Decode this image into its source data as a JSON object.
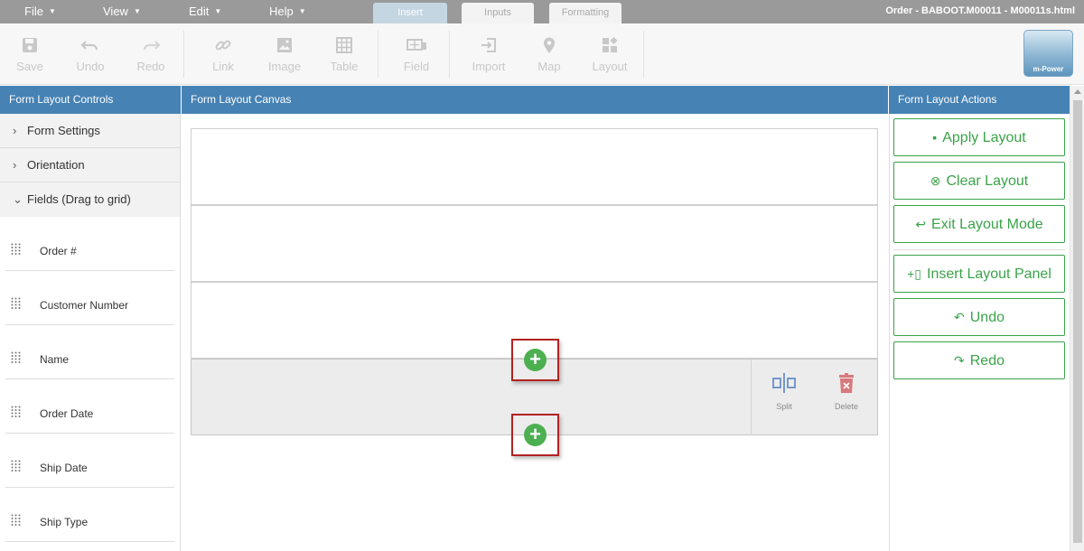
{
  "menu": {
    "file": "File",
    "view": "View",
    "edit": "Edit",
    "help": "Help"
  },
  "tabs": {
    "insert": "Insert",
    "inputs": "Inputs",
    "formatting": "Formatting"
  },
  "document_title": "Order - BABOOT.M00011 - M00011s.html",
  "toolbar": {
    "save": "Save",
    "undo": "Undo",
    "redo": "Redo",
    "link": "Link",
    "image": "Image",
    "table": "Table",
    "field": "Field",
    "import": "Import",
    "map": "Map",
    "layout": "Layout"
  },
  "logo_text": "m-Power",
  "controls": {
    "header": "Form Layout Controls",
    "sections": [
      {
        "label": "Form Settings",
        "expanded": false
      },
      {
        "label": "Orientation",
        "expanded": false
      },
      {
        "label": "Fields (Drag to grid)",
        "expanded": true
      }
    ],
    "fields": [
      "Order #",
      "Customer Number",
      "Name",
      "Order Date",
      "Ship Date",
      "Ship Type"
    ]
  },
  "canvas": {
    "header": "Form Layout Canvas",
    "row_actions": {
      "split": "Split",
      "delete": "Delete"
    },
    "add_symbol": "+"
  },
  "actions": {
    "header": "Form Layout Actions",
    "apply": "Apply Layout",
    "clear": "Clear Layout",
    "exit": "Exit Layout Mode",
    "insert_panel": "Insert Layout Panel",
    "undo": "Undo",
    "redo": "Redo"
  },
  "colors": {
    "header_blue": "#4682b4",
    "accent_green": "#3aa34a",
    "add_green": "#4caf50",
    "highlight_red": "#b22222"
  }
}
